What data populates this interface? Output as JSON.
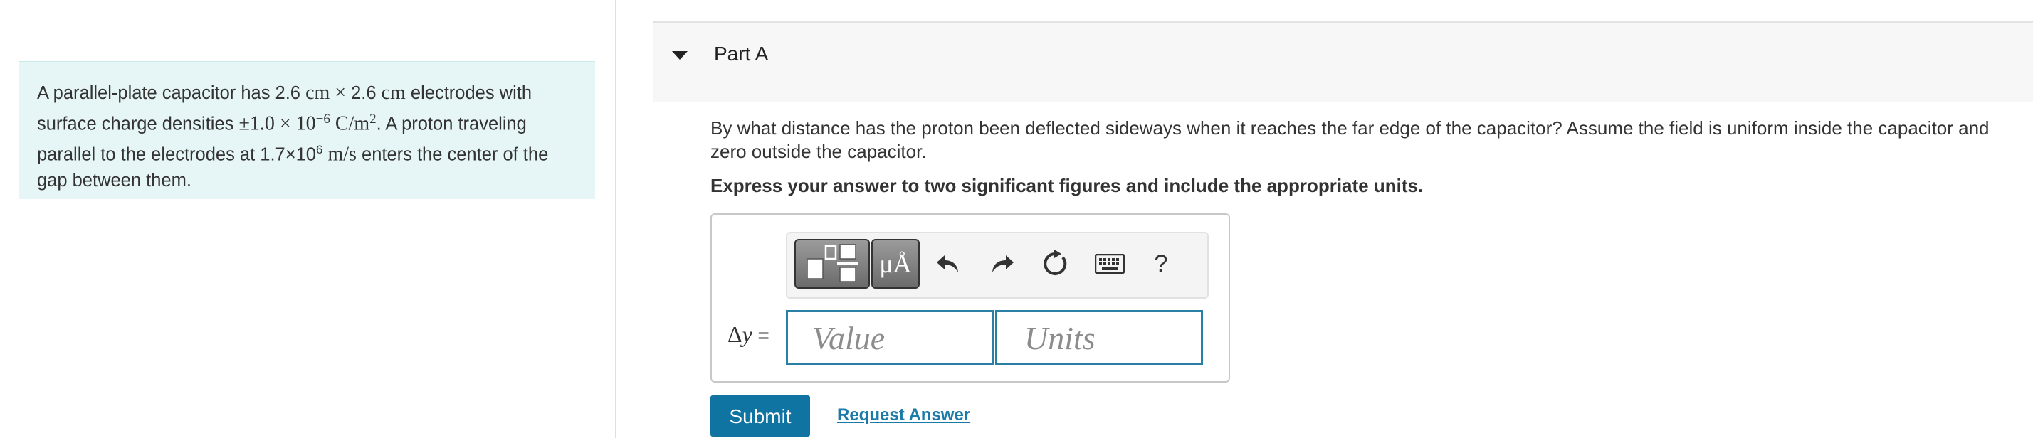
{
  "problem": {
    "t1": "A parallel-plate capacitor has 2.6 ",
    "cm1": "cm",
    "times1": " × ",
    "t2": "2.6 ",
    "cm2": "cm",
    "t3": " electrodes with surface charge densities ",
    "pm": "±",
    "coef": "1.0",
    "times2": " × ",
    "base": "10",
    "exp": "−6",
    "unit1": " C/m",
    "sq": "2",
    "t4": ". A proton traveling parallel to the electrodes at 1.7×10",
    "exp2": "6",
    "unit2": " m/s",
    "t5": " enters the center of the gap between them."
  },
  "part": {
    "title": "Part A"
  },
  "question": "By what distance has the proton been deflected sideways when it reaches the far edge of the capacitor? Assume the field is uniform inside the capacitor and zero outside the capacitor.",
  "instruction": "Express your answer to two significant figures and include the appropriate units.",
  "toolbar": {
    "units_label": "μÅ",
    "help_label": "?"
  },
  "answer": {
    "var": "Δ",
    "var_y": "y",
    "eq": " =",
    "value_placeholder": "Value",
    "units_placeholder": "Units"
  },
  "buttons": {
    "submit": "Submit",
    "request": "Request Answer"
  },
  "colors": {
    "accent": "#0f74a1",
    "panel_bg": "#e6f6f6",
    "field_border": "#2a7fa5"
  }
}
